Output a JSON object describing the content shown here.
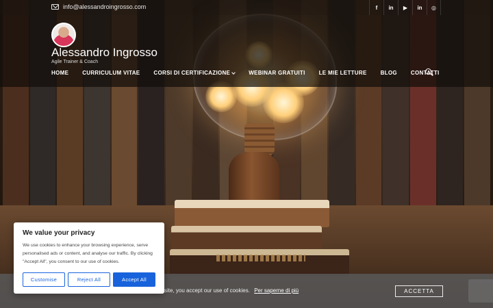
{
  "topbar": {
    "email": "info@alessandroingrosso.com",
    "socials": [
      {
        "icon": "facebook-icon",
        "glyph": "f"
      },
      {
        "icon": "linkedin-icon",
        "glyph": "in"
      },
      {
        "icon": "youtube-icon",
        "glyph": "▶"
      },
      {
        "icon": "linkedin-icon",
        "glyph": "in"
      },
      {
        "icon": "instagram-icon",
        "glyph": "◎"
      }
    ]
  },
  "header": {
    "title": "Alessandro Ingrosso",
    "tagline": "Agile Trainer & Coach",
    "nav": [
      {
        "label": "HOME"
      },
      {
        "label": "CURRICULUM VITAE"
      },
      {
        "label": "CORSI DI CERTIFICAZIONE",
        "dropdown": true
      },
      {
        "label": "WEBINAR GRATUITI"
      },
      {
        "label": "LE MIE LETTURE"
      },
      {
        "label": "BLOG"
      },
      {
        "label": "CONTATTI"
      }
    ]
  },
  "cookie_bar": {
    "text": "site, you accept our use of cookies.",
    "link": "Per saperne di più",
    "button": "ACCETTA"
  },
  "consent": {
    "title": "We value your privacy",
    "body": "We use cookies to enhance your browsing experience, serve personalised ads or content, and analyse our traffic. By clicking \"Accept All\", you consent to our use of cookies.",
    "customise": "Customise",
    "reject": "Reject All",
    "accept": "Accept All"
  },
  "colors": {
    "accent": "#1863dc",
    "header_bg": "#120e0a"
  }
}
